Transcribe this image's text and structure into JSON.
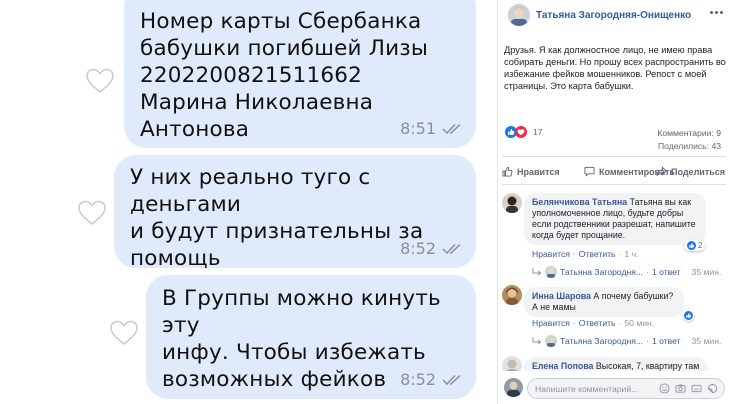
{
  "chat": {
    "messages": [
      {
        "lines": [
          "Номер карты Сбербанка",
          "бабушки погибшей Лизы",
          "2202200821511662",
          "Марина Николаевна Антонова"
        ],
        "time": "8:51"
      },
      {
        "lines": [
          "У них реально туго с деньгами",
          "и будут признательны за",
          "помощь"
        ],
        "time": "8:52"
      },
      {
        "lines": [
          "В Группы можно кинуть эту",
          "инфу. Чтобы избежать",
          "возможных фейков"
        ],
        "time": "8:52"
      }
    ]
  },
  "post": {
    "author": "Татьяна Загородняя-Онищенко",
    "text": "Друзья. Я как должностное лицо, не имею права собирать деньги. Но прошу всех распространить во избежание фейков мошенников. Репост с моей страницы. Это карта бабушки.",
    "reactions_count": "17",
    "comments_count": "Комментарии: 9",
    "shares_count": "Поделились: 43",
    "actions": {
      "like": "Нравится",
      "comment": "Комментировать",
      "share": "Поделиться"
    },
    "comments": [
      {
        "name": "Белянчикова Татьяна",
        "text": "Татьяна вы как уполномоченное лицо, будьте добры если родственники разрешат, напишите когда будет прощание.",
        "reactions": "2",
        "like": "Нравится",
        "reply": "Ответить",
        "time": "1 ч.",
        "reply_author": "Татьяна Загородня...",
        "reply_count": "1 ответ",
        "reply_time": "35 мин."
      },
      {
        "name": "Инна Шарова",
        "text": "А почему бабушки? А не мамы",
        "like": "Нравится",
        "reply": "Ответить",
        "time": "50 мин.",
        "reply_author": "Татьяна Загородня...",
        "reply_count": "1 ответ",
        "reply_time": "35 мин."
      },
      {
        "name": "Елена Попова",
        "text": "Высокая, 7, квартиру там"
      }
    ],
    "write_comment_placeholder": "Напишите комментарий...",
    "colors": {
      "link": "#385898",
      "like_blue": "#1877f2",
      "love_red": "#f02849",
      "bubble": "#dfeafb"
    }
  }
}
